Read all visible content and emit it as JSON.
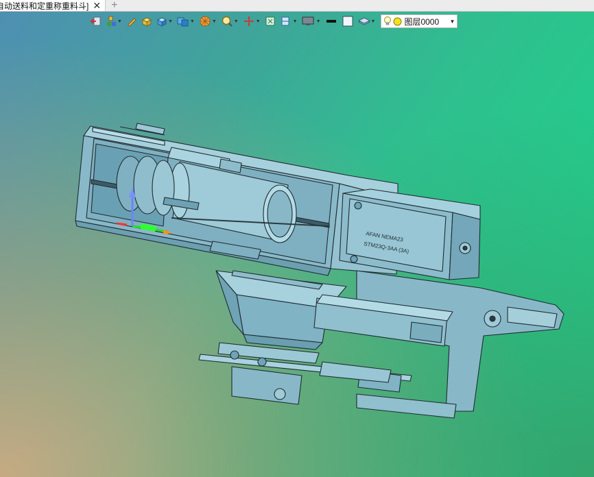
{
  "tab": {
    "title": "自动送料和定重称重料斗]",
    "close_glyph": "✕",
    "add_glyph": "+"
  },
  "toolbar": {
    "icons": [
      "exit-icon",
      "color-icon",
      "pencil-icon",
      "box-icon",
      "cube-icon",
      "view-cube-icon",
      "render-icon",
      "zoom-icon",
      "pan-icon",
      "fit-icon",
      "section-icon",
      "display-icon",
      "line-style-icon",
      "fill-icon",
      "layer-stack-icon"
    ],
    "layer_name": "图层0000"
  },
  "motor": {
    "label_line1": "AFAN NEMA23",
    "label_line2": "STM23Q-3AA (3A)"
  },
  "colors": {
    "part_fill": "#8ebfcf",
    "part_dark": "#6fa3b6",
    "part_edge": "#1f2a30",
    "toolbar_bg": "#ececec"
  }
}
